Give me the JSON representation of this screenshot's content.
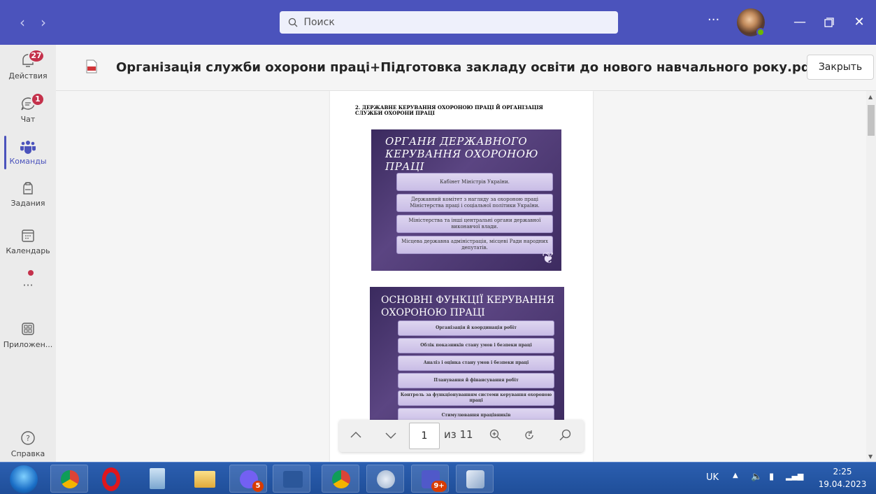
{
  "titlebar": {
    "back_icon": "chevron-left-icon",
    "forward_icon": "chevron-right-icon",
    "search_placeholder": "Поиск",
    "more_label": "···",
    "min_icon": "minimize-icon",
    "max_icon": "maximize-icon",
    "close_icon": "close-icon"
  },
  "rail": {
    "items": [
      {
        "label": "Действия",
        "icon": "bell-icon",
        "badge": "27"
      },
      {
        "label": "Чат",
        "icon": "chat-icon",
        "badge": "1"
      },
      {
        "label": "Команды",
        "icon": "teams-icon",
        "active": true
      },
      {
        "label": "Задания",
        "icon": "assignments-icon"
      },
      {
        "label": "Календарь",
        "icon": "calendar-icon"
      },
      {
        "label": "···",
        "icon": "more-icon"
      },
      {
        "label": "Приложен...",
        "icon": "apps-icon"
      },
      {
        "label": "Справка",
        "icon": "help-icon"
      }
    ]
  },
  "header": {
    "title": "Організація служби охорони праці+Підготовка закладу освіти до нового навчального року.pdf",
    "close_label": "Закрыть"
  },
  "document": {
    "section_heading": "2. ДЕРЖАВНЕ КЕРУВАННЯ ОХОРОНОЮ ПРАЦІ Й ОРГАНІЗАЦІЯ СЛУЖБИ ОХОРОНИ ПРАЦІ",
    "slide1": {
      "title_line1": "ОРГАНИ ДЕРЖАВНОГО",
      "title_line2": "КЕРУВАННЯ ОХОРОНОЮ ПРАЦІ",
      "items": [
        "Кабінет Міністрів України.",
        "Державний комітет з нагляду за охороною праці Міністерства праці і соціальної політики України.",
        "Міністерства та інші центральні органи державної виконавчої влади.",
        "Місцева державна адміністрація, місцеві Ради народних депутатів."
      ]
    },
    "slide2": {
      "title_line1": "ОСНОВНІ ФУНКЦІЇ КЕРУВАННЯ",
      "title_line2": "ОХОРОНОЮ ПРАЦІ",
      "items": [
        "Організація й координація робіт",
        "Облік показників стану умов і безпеки праці",
        "Аналіз і оцінка стану умов і безпеки праці",
        "Планування й фінансування робіт",
        "Контроль за функціонуванням системи керування охороною праці",
        "Стимулювання працівників"
      ]
    }
  },
  "pdf_toolbar": {
    "page_value": "1",
    "page_count": "из 11"
  },
  "taskbar": {
    "apps": [
      {
        "name": "chrome-icon"
      },
      {
        "name": "opera-icon"
      },
      {
        "name": "calculator-icon"
      },
      {
        "name": "file-explorer-icon"
      },
      {
        "name": "viber-icon",
        "badge": "5"
      },
      {
        "name": "word-icon"
      },
      {
        "name": "chrome-icon"
      },
      {
        "name": "snipping-tool-icon"
      },
      {
        "name": "teams-icon",
        "badge": "9+"
      },
      {
        "name": "other-app-icon"
      }
    ],
    "lang": "UK",
    "time": "2:25",
    "date": "19.04.2023"
  }
}
